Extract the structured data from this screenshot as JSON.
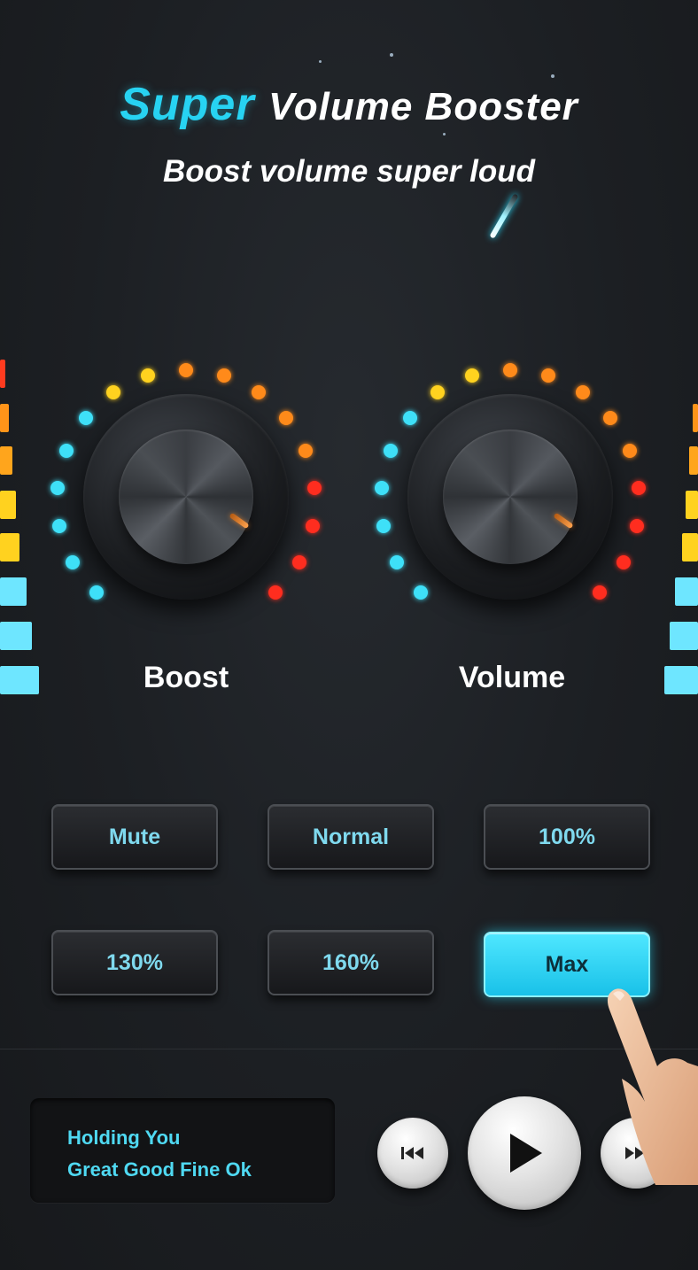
{
  "header": {
    "title_accent": "Super",
    "title_rest": "Volume Booster",
    "subtitle": "Boost volume super loud"
  },
  "knobs": [
    {
      "label": "Boost"
    },
    {
      "label": "Volume"
    }
  ],
  "presets": [
    {
      "label": "Mute",
      "active": false
    },
    {
      "label": "Normal",
      "active": false
    },
    {
      "label": "100%",
      "active": false
    },
    {
      "label": "130%",
      "active": false
    },
    {
      "label": "160%",
      "active": false
    },
    {
      "label": "Max",
      "active": true
    }
  ],
  "player": {
    "track_line1": "Holding You",
    "track_line2": "Great Good Fine Ok",
    "prev_icon": "skip-previous-icon",
    "play_icon": "play-icon",
    "next_icon": "skip-next-icon"
  },
  "colors": {
    "accent": "#27d3f2",
    "dot_cyan": "#3ee0f8",
    "dot_yellow": "#ffd21f",
    "dot_orange": "#ff8a1a",
    "dot_red": "#ff2d1f"
  }
}
